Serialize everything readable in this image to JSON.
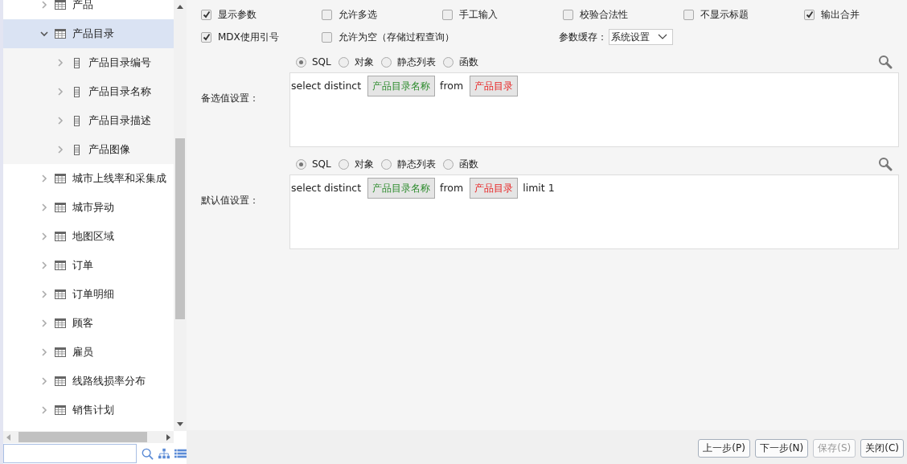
{
  "tree": [
    {
      "label": "产品",
      "kind": "table",
      "expanded": false,
      "selected": false
    },
    {
      "label": "产品目录",
      "kind": "table",
      "expanded": true,
      "selected": true,
      "children": [
        {
          "label": "产品目录编号",
          "kind": "field",
          "expanded": false,
          "selected": false
        },
        {
          "label": "产品目录名称",
          "kind": "field",
          "expanded": false,
          "selected": false
        },
        {
          "label": "产品目录描述",
          "kind": "field",
          "expanded": false,
          "selected": false
        },
        {
          "label": "产品图像",
          "kind": "field",
          "expanded": false,
          "selected": false
        }
      ]
    },
    {
      "label": "城市上线率和采集成",
      "kind": "table",
      "expanded": false,
      "selected": false
    },
    {
      "label": "城市异动",
      "kind": "table",
      "expanded": false,
      "selected": false
    },
    {
      "label": "地图区域",
      "kind": "table",
      "expanded": false,
      "selected": false
    },
    {
      "label": "订单",
      "kind": "table",
      "expanded": false,
      "selected": false
    },
    {
      "label": "订单明细",
      "kind": "table",
      "expanded": false,
      "selected": false
    },
    {
      "label": "顾客",
      "kind": "table",
      "expanded": false,
      "selected": false
    },
    {
      "label": "雇员",
      "kind": "table",
      "expanded": false,
      "selected": false
    },
    {
      "label": "线路线损率分布",
      "kind": "table",
      "expanded": false,
      "selected": false
    },
    {
      "label": "销售计划",
      "kind": "table",
      "expanded": false,
      "selected": false
    }
  ],
  "options_row_1": [
    {
      "label": "显示参数",
      "checked": true
    },
    {
      "label": "允许多选",
      "checked": false
    },
    {
      "label": "手工输入",
      "checked": false
    },
    {
      "label": "校验合法性",
      "checked": false
    },
    {
      "label": "不显示标题",
      "checked": false
    },
    {
      "label": "输出合并",
      "checked": true
    }
  ],
  "options_row_2": [
    {
      "label": "MDX使用引号",
      "checked": true
    },
    {
      "label": "允许为空（存储过程查询）",
      "checked": false
    }
  ],
  "cache": {
    "label": "参数缓存：",
    "value": "系统设置"
  },
  "sections": [
    {
      "label": "备选值设置：",
      "modes": [
        {
          "label": "SQL",
          "selected": true
        },
        {
          "label": "对象",
          "selected": false
        },
        {
          "label": "静态列表",
          "selected": false
        },
        {
          "label": "函数",
          "selected": false
        }
      ],
      "tokens": [
        {
          "kind": "text",
          "text": "select distinct"
        },
        {
          "kind": "field",
          "text": "产品目录名称"
        },
        {
          "kind": "text",
          "text": "from"
        },
        {
          "kind": "table",
          "text": "产品目录"
        }
      ]
    },
    {
      "label": "默认值设置：",
      "modes": [
        {
          "label": "SQL",
          "selected": true
        },
        {
          "label": "对象",
          "selected": false
        },
        {
          "label": "静态列表",
          "selected": false
        },
        {
          "label": "函数",
          "selected": false
        }
      ],
      "tokens": [
        {
          "kind": "text",
          "text": "select distinct"
        },
        {
          "kind": "field",
          "text": "产品目录名称"
        },
        {
          "kind": "text",
          "text": "from"
        },
        {
          "kind": "table",
          "text": "产品目录"
        },
        {
          "kind": "text",
          "text": "limit 1"
        }
      ]
    }
  ],
  "buttons": [
    {
      "label": "上一步(P)",
      "disabled": false
    },
    {
      "label": "下一步(N)",
      "disabled": false
    },
    {
      "label": "保存(S)",
      "disabled": true
    },
    {
      "label": "关闭(C)",
      "disabled": false
    }
  ]
}
